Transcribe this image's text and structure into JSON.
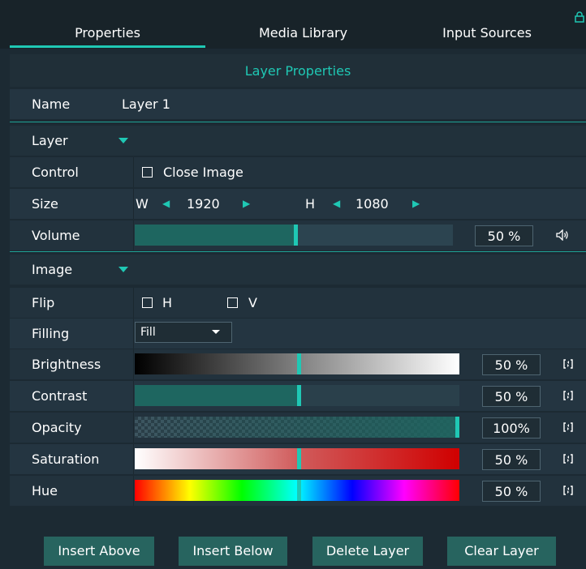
{
  "tabs": [
    {
      "label": "Properties",
      "active": true
    },
    {
      "label": "Media Library",
      "active": false
    },
    {
      "label": "Input Sources",
      "active": false
    }
  ],
  "panel_title": "Layer Properties",
  "name": {
    "label": "Name",
    "value": "Layer 1"
  },
  "sections": {
    "layer": "Layer",
    "image": "Image"
  },
  "control": {
    "label": "Control",
    "checkbox_label": "Close Image",
    "checked": false
  },
  "size": {
    "label": "Size",
    "w_label": "W",
    "w_value": "1920",
    "h_label": "H",
    "h_value": "1080"
  },
  "volume": {
    "label": "Volume",
    "percent_text": "50 %",
    "value": 0.5,
    "speaker_icon": "speaker-icon"
  },
  "flip": {
    "label": "Flip",
    "h_label": "H",
    "v_label": "V",
    "h_checked": false,
    "v_checked": false
  },
  "filling": {
    "label": "Filling",
    "selected": "Fill"
  },
  "adjustments": [
    {
      "label": "Brightness",
      "percent_text": "50 %",
      "value": 0.5
    },
    {
      "label": "Contrast",
      "percent_text": "50 %",
      "value": 0.5
    },
    {
      "label": "Opacity",
      "percent_text": "100%",
      "value": 1.0
    },
    {
      "label": "Saturation",
      "percent_text": "50 %",
      "value": 0.5
    },
    {
      "label": "Hue",
      "percent_text": "50 %",
      "value": 0.5
    }
  ],
  "buttons": {
    "insert_above": "Insert Above",
    "insert_below": "Insert Below",
    "delete_layer": "Delete Layer",
    "clear_layer": "Clear Layer"
  },
  "colors": {
    "accent": "#1fc8b4",
    "panel_bg": "#1c2a33",
    "button_bg": "#27645f",
    "row_bg": "#243541"
  }
}
